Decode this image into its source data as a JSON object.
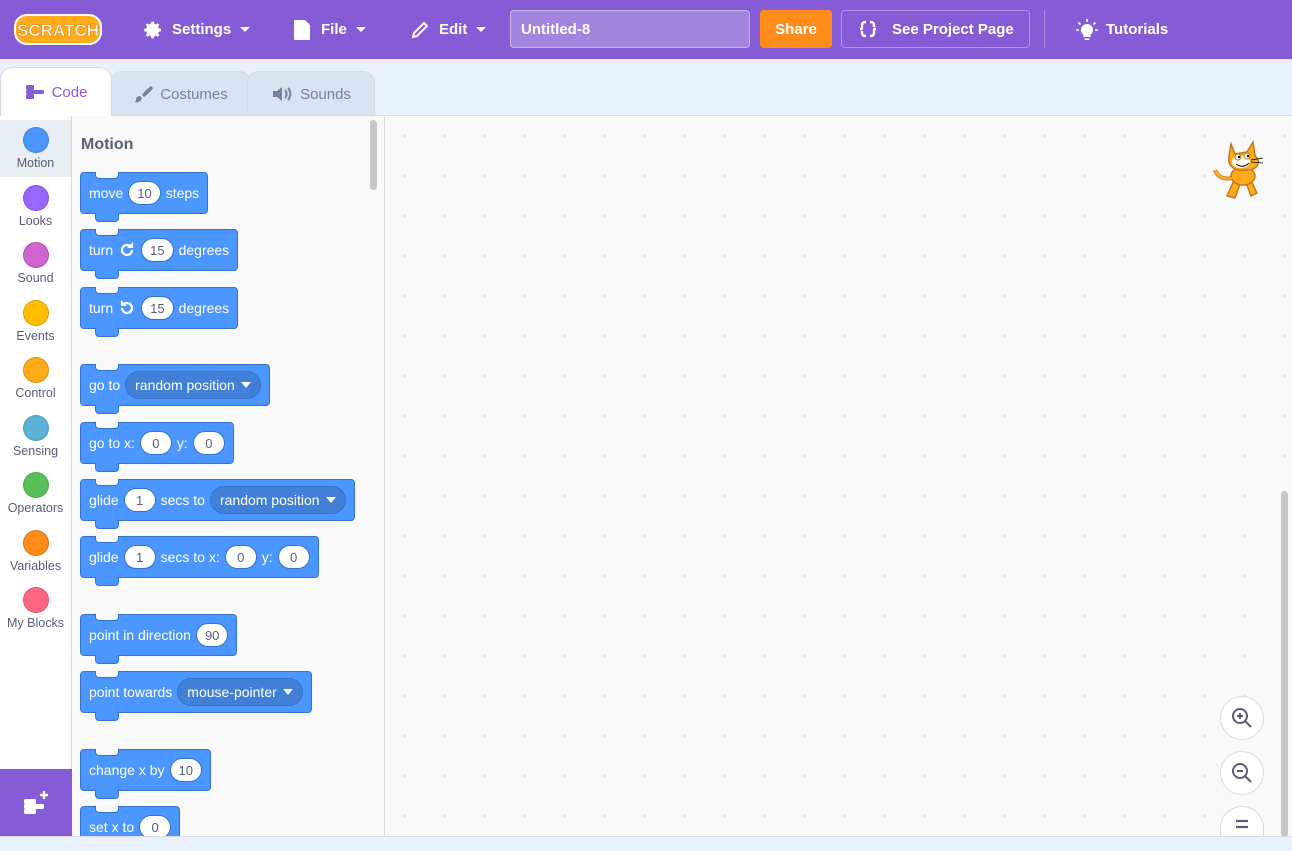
{
  "menubar": {
    "logo_text": "SCRATCH",
    "settings_label": "Settings",
    "file_label": "File",
    "edit_label": "Edit",
    "project_title": "Untitled-8",
    "share_label": "Share",
    "see_project_page_label": "See Project Page",
    "tutorials_label": "Tutorials"
  },
  "tabs": [
    {
      "label": "Code"
    },
    {
      "label": "Costumes"
    },
    {
      "label": "Sounds"
    }
  ],
  "categories": [
    {
      "label": "Motion",
      "color": "#4c97ff"
    },
    {
      "label": "Looks",
      "color": "#9966ff"
    },
    {
      "label": "Sound",
      "color": "#cf63cf"
    },
    {
      "label": "Events",
      "color": "#ffbf00"
    },
    {
      "label": "Control",
      "color": "#ffab19"
    },
    {
      "label": "Sensing",
      "color": "#5cb1d6"
    },
    {
      "label": "Operators",
      "color": "#59c059"
    },
    {
      "label": "Variables",
      "color": "#ff8c1a"
    },
    {
      "label": "My Blocks",
      "color": "#ff6680"
    }
  ],
  "palette": {
    "title": "Motion",
    "blocks": {
      "move": {
        "pre": "move",
        "value": "10",
        "post": "steps"
      },
      "turn_right": {
        "pre": "turn",
        "value": "15",
        "post": "degrees"
      },
      "turn_left": {
        "pre": "turn",
        "value": "15",
        "post": "degrees"
      },
      "goto": {
        "pre": "go to",
        "option": "random position"
      },
      "goto_xy": {
        "pre": "go to x:",
        "x": "0",
        "mid": "y:",
        "y": "0"
      },
      "glide_to": {
        "pre": "glide",
        "value": "1",
        "mid": "secs to",
        "option": "random position"
      },
      "glide_xy": {
        "pre": "glide",
        "value": "1",
        "mid": "secs to x:",
        "x": "0",
        "mid2": "y:",
        "y": "0"
      },
      "point_direction": {
        "pre": "point in direction",
        "value": "90"
      },
      "point_towards": {
        "pre": "point towards",
        "option": "mouse-pointer"
      },
      "change_x": {
        "pre": "change x by",
        "value": "10"
      },
      "set_x": {
        "pre": "set x to",
        "value": "0"
      }
    }
  },
  "colors": {
    "menubar": "#855cd6",
    "share": "#ff8c1a",
    "motion_block": "#4c97ff"
  },
  "icons": {
    "settings": "gear-icon",
    "file": "file-icon",
    "edit": "pencil-icon",
    "project_page": "see-inside-icon",
    "tutorials": "lightbulb-icon",
    "zoom_in": "zoom-in-icon",
    "zoom_out": "zoom-out-icon",
    "zoom_reset": "zoom-reset-icon",
    "extension": "add-extension-icon"
  }
}
